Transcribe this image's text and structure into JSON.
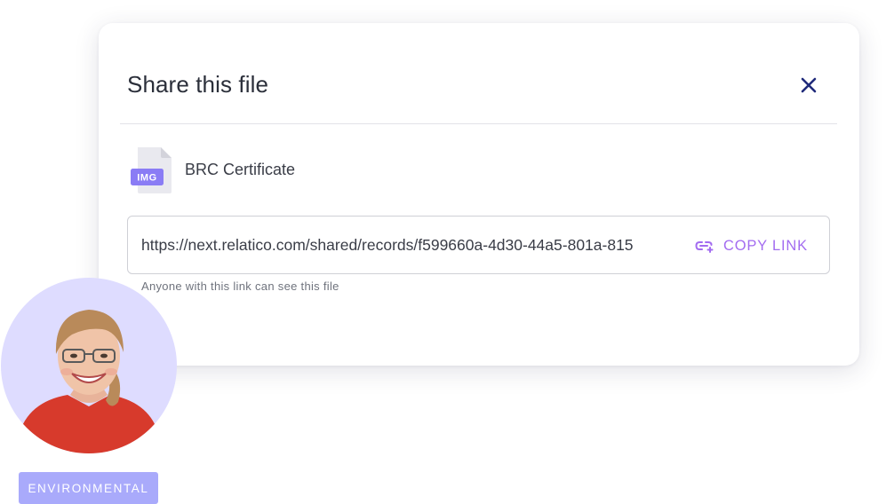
{
  "dialog": {
    "title": "Share this file",
    "close_icon": "close-icon",
    "file": {
      "type_badge": "IMG",
      "name": "BRC Certificate"
    },
    "link": {
      "value": "https://next.relatico.com/shared/records/f599660a-4d30-44a5-801a-815",
      "copy_label": "COPY LINK",
      "copy_icon": "link-add-icon",
      "helper": "Anyone with this link can see this file"
    }
  },
  "profile": {
    "tag": "ENVIRONMENTAL"
  },
  "colors": {
    "accent": "#a36cf0",
    "close": "#1f2a7a",
    "badge": "#8a7cf5",
    "avatar_bg": "#dedcff",
    "tag_bg": "#a9aafb"
  }
}
